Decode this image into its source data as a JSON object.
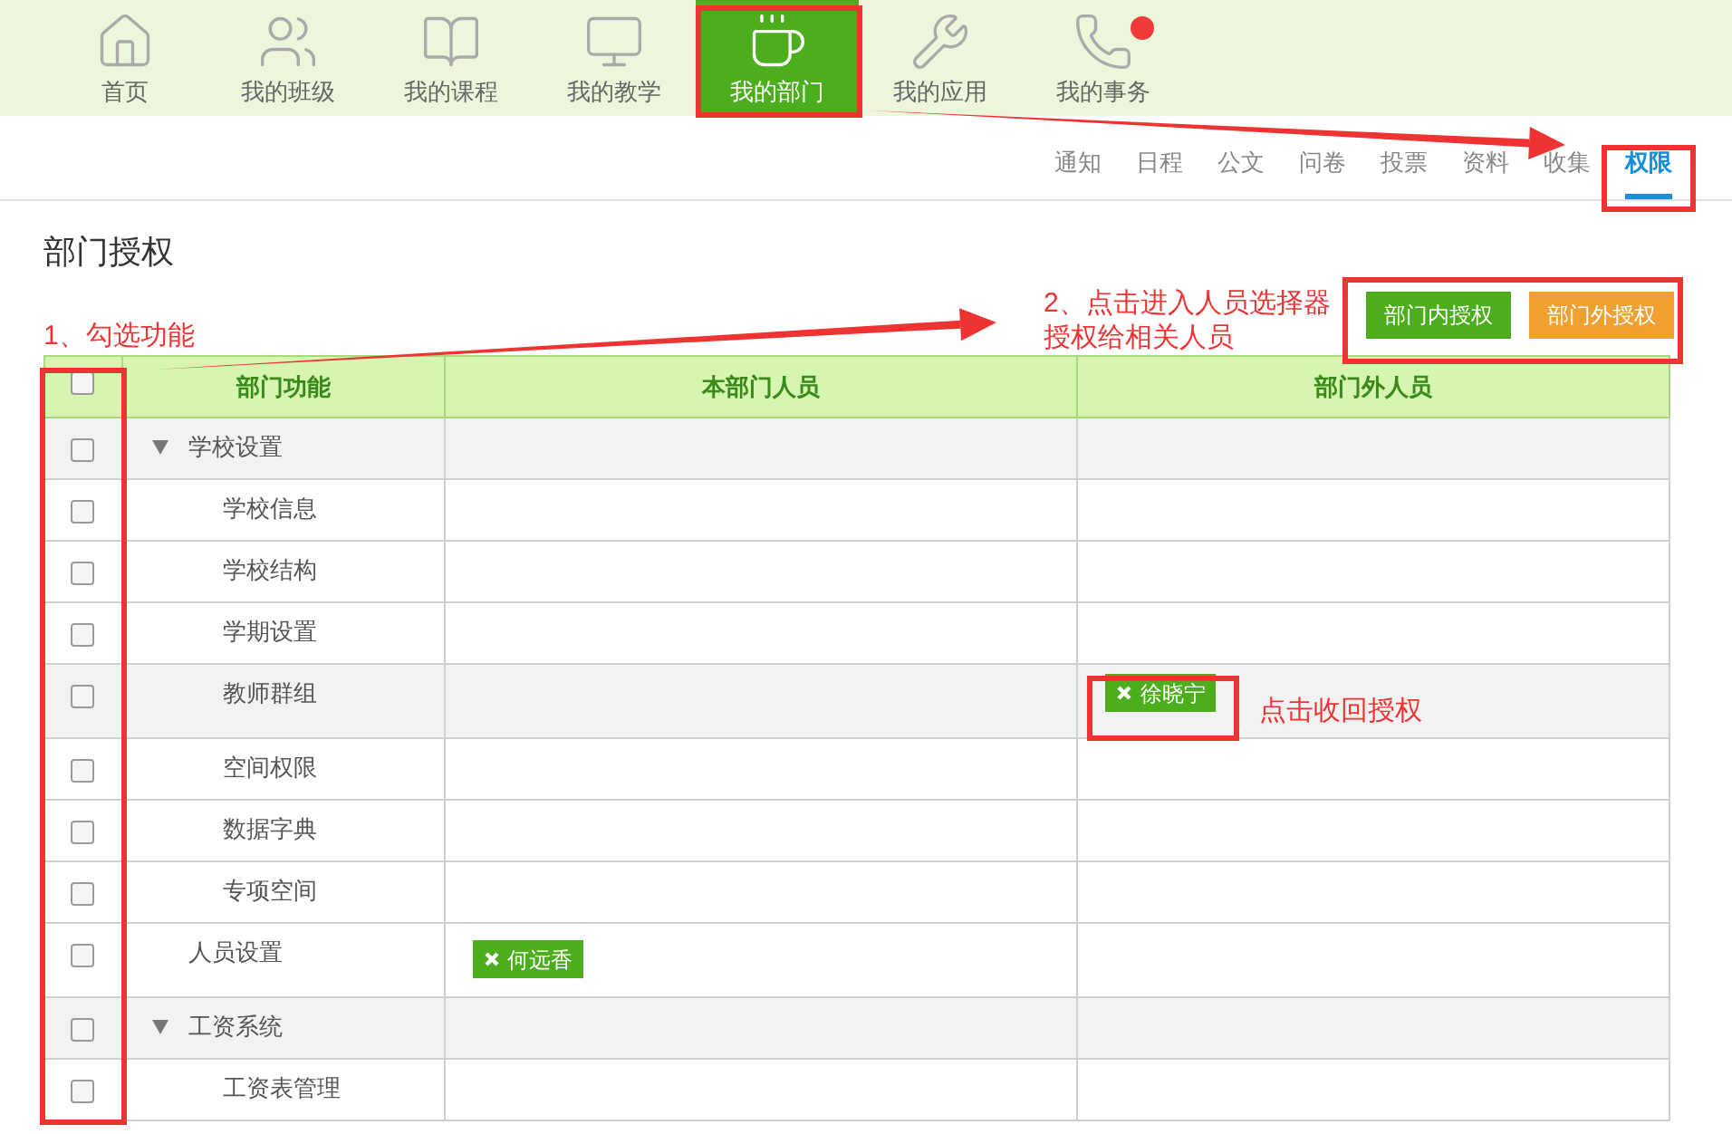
{
  "nav": [
    {
      "label": "首页",
      "selected": false,
      "badge": false
    },
    {
      "label": "我的班级",
      "selected": false,
      "badge": false
    },
    {
      "label": "我的课程",
      "selected": false,
      "badge": false
    },
    {
      "label": "我的教学",
      "selected": false,
      "badge": false
    },
    {
      "label": "我的部门",
      "selected": true,
      "badge": false
    },
    {
      "label": "我的应用",
      "selected": false,
      "badge": false
    },
    {
      "label": "我的事务",
      "selected": false,
      "badge": true
    }
  ],
  "subtabs": [
    {
      "label": "通知",
      "selected": false
    },
    {
      "label": "日程",
      "selected": false
    },
    {
      "label": "公文",
      "selected": false
    },
    {
      "label": "问卷",
      "selected": false
    },
    {
      "label": "投票",
      "selected": false
    },
    {
      "label": "资料",
      "selected": false
    },
    {
      "label": "收集",
      "selected": false
    },
    {
      "label": "权限",
      "selected": true
    }
  ],
  "page_title": "部门授权",
  "buttons": [
    {
      "label": "部门内授权",
      "kind": "internal"
    },
    {
      "label": "部门外授权",
      "kind": "external"
    }
  ],
  "table": {
    "columns": [
      "部门功能",
      "本部门人员",
      "部门外人员"
    ],
    "header_checked": false,
    "rows": [
      {
        "name": "学校设置",
        "checked": false,
        "expanded": true,
        "highlighted": true,
        "children": [
          {
            "name": "学校信息",
            "checked": false,
            "highlighted": false
          },
          {
            "name": "学校结构",
            "checked": false,
            "highlighted": false
          },
          {
            "name": "学期设置",
            "checked": false,
            "highlighted": false
          },
          {
            "name": "教师群组",
            "checked": false,
            "highlighted": true,
            "external": [
              "徐晓宁"
            ]
          },
          {
            "name": "空间权限",
            "checked": false,
            "highlighted": false
          },
          {
            "name": "数据字典",
            "checked": false,
            "highlighted": false
          },
          {
            "name": "专项空间",
            "checked": false,
            "highlighted": false
          }
        ]
      },
      {
        "name": "人员设置",
        "checked": false,
        "highlighted": false,
        "internal": [
          "何远香"
        ]
      },
      {
        "name": "工资系统",
        "checked": false,
        "expanded": true,
        "highlighted": true,
        "children": [
          {
            "name": "工资表管理",
            "checked": false,
            "highlighted": false
          }
        ]
      }
    ]
  },
  "annotations": {
    "step_1": "1、勾选功能",
    "step_2_line_1": "2、点击进入人员选择器",
    "step_2_line_2": "授权给相关人员",
    "revoke_hint": "点击收回授权"
  }
}
